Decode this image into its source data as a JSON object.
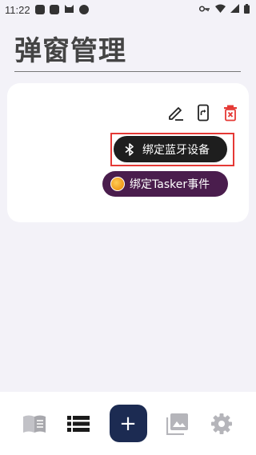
{
  "status_bar": {
    "time": "11:22"
  },
  "page": {
    "title": "弹窗管理"
  },
  "card": {
    "bluetooth_button_label": "绑定蓝牙设备",
    "tasker_button_label": "绑定Tasker事件"
  },
  "bottom_nav": {
    "fab_label": "+"
  },
  "colors": {
    "background": "#f3f2f8",
    "bt_chip": "#1e1e1e",
    "tasker_chip": "#4a1d4d",
    "fab": "#1c2b52",
    "delete_icon": "#e53935",
    "highlight": "#e53935"
  },
  "icons": {
    "status": [
      "square-app-icon",
      "square-app-icon",
      "cat-icon",
      "circle-icon",
      "key-icon",
      "wifi-icon",
      "signal-icon",
      "battery-icon"
    ],
    "card_actions": [
      "edit-icon",
      "phone-share-icon",
      "delete-icon"
    ],
    "nav": [
      "book-icon",
      "list-icon",
      "add-icon",
      "image-icon",
      "settings-icon"
    ]
  }
}
